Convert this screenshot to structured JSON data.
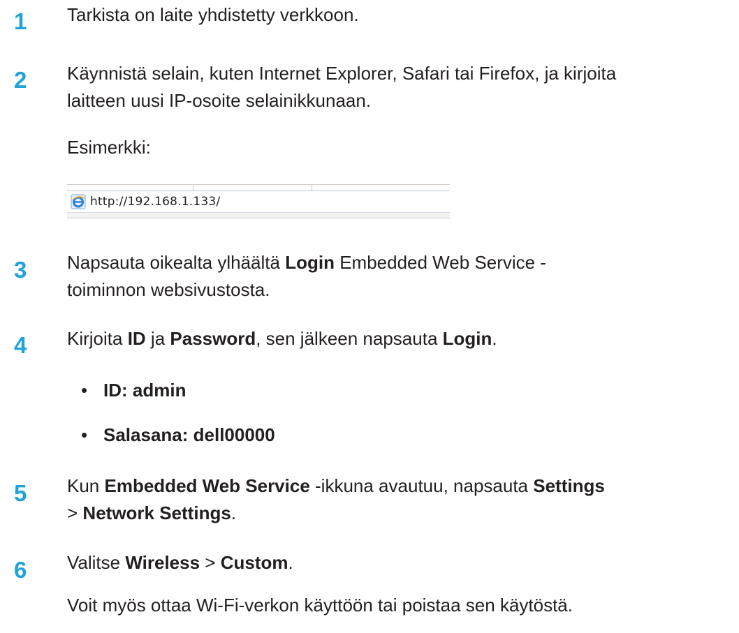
{
  "steps": [
    {
      "number": "1",
      "line1": "Tarkista on laite yhdistetty verkkoon."
    },
    {
      "number": "2",
      "line1": "Käynnistä selain, kuten Internet Explorer, Safari tai Firefox, ja kirjoita",
      "line2": "laitteen uusi IP-osoite selainikkunaan.",
      "example_label": "Esimerkki:",
      "example_url": "http://192.168.1.133/"
    },
    {
      "number": "3",
      "line1_pre": "Napsauta oikealta ylhäältä ",
      "line1_bold": "Login",
      "line1_post": " Embedded Web Service -",
      "line2": "toiminnon websivustosta."
    },
    {
      "number": "4",
      "t1": "Kirjoita ",
      "b1": "ID",
      "t2": " ja ",
      "b2": "Password",
      "t3": ", sen jälkeen napsauta ",
      "b3": "Login",
      "t4": ".",
      "bullets": [
        "ID: admin",
        "Salasana: dell00000"
      ],
      "bullet_char": "•"
    },
    {
      "number": "5",
      "t1": "Kun ",
      "b1": "Embedded Web Service",
      "t2": " -ikkuna avautuu, napsauta ",
      "b2": "Settings",
      "l2_t1": "> ",
      "l2_b1": "Network Settings",
      "l2_t2": "."
    },
    {
      "number": "6",
      "t1": "Valitse ",
      "b1": "Wireless",
      "t2": " > ",
      "b2": "Custom",
      "t3": ".",
      "note": "Voit myös ottaa Wi-Fi-verkon käyttöön tai poistaa sen käytöstä."
    }
  ],
  "colors": {
    "step_number": "#1fa3d9",
    "text": "#231f20",
    "ie_icon": "#2a7fd4"
  },
  "icons": {
    "address_bar_icon": "internet-explorer-icon"
  }
}
